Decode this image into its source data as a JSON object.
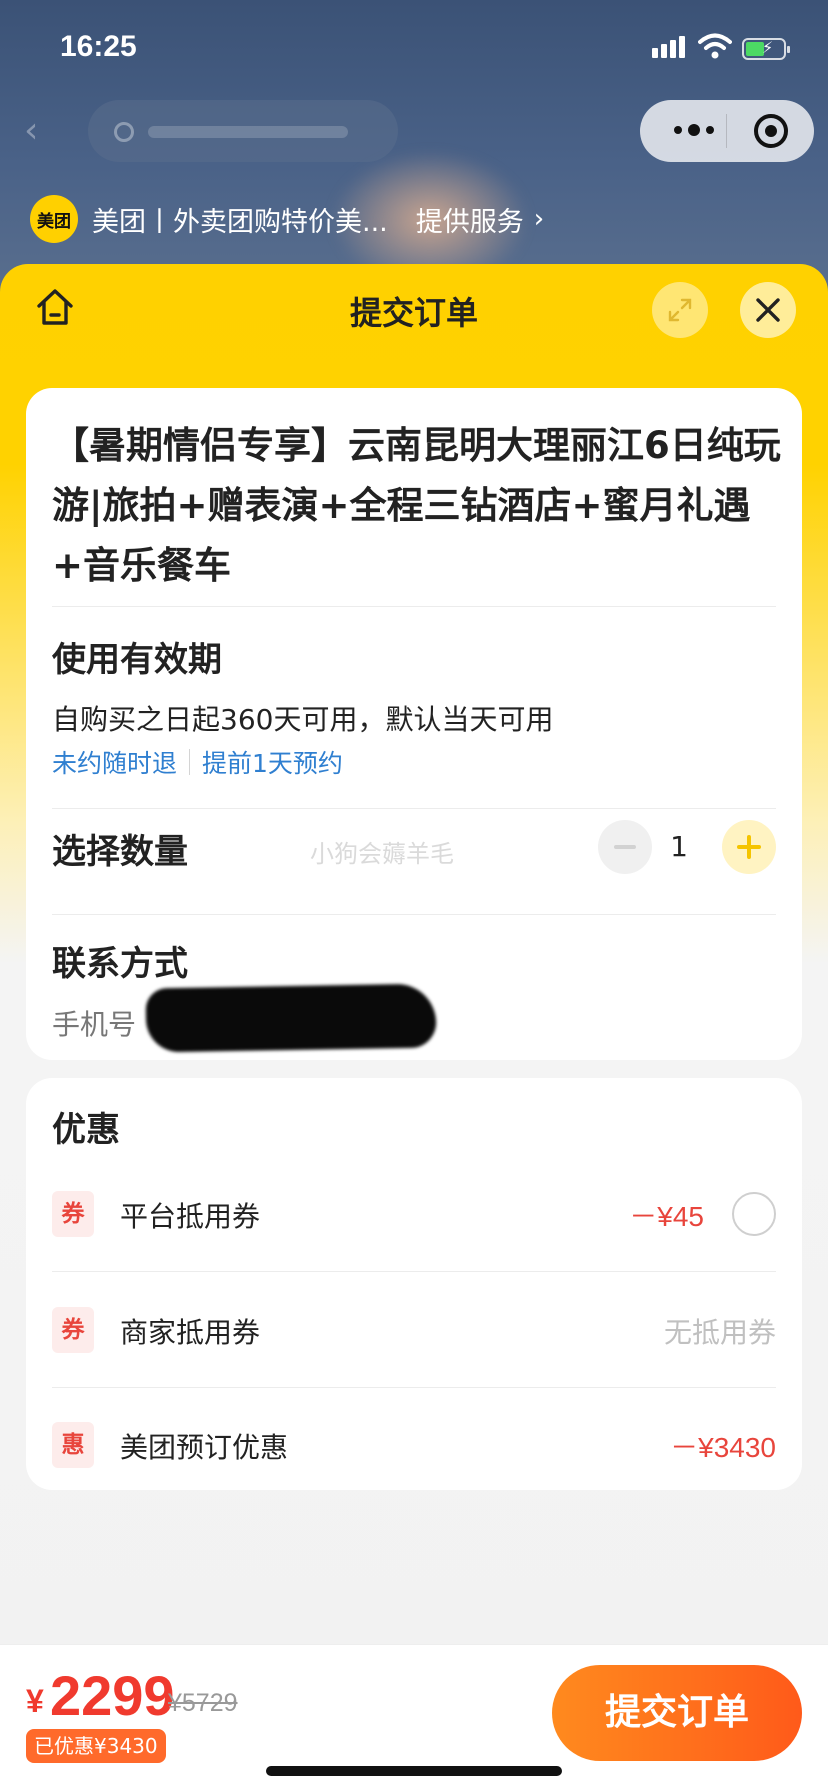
{
  "status_bar": {
    "time": "16:25"
  },
  "mini_program": {
    "logo_text": "美团",
    "name": "美团丨外卖团购特价美...",
    "service_link": "提供服务",
    "service_chevron": "›"
  },
  "sheet": {
    "title": "提交订单",
    "icons": [
      "home-icon",
      "expand-icon",
      "close-icon"
    ]
  },
  "product": {
    "title": "【暑期情侣专享】云南昆明大理丽江6日纯玩游|旅拍+赠表演+全程三钻酒店+蜜月礼遇+音乐餐车"
  },
  "validity": {
    "label": "使用有效期",
    "text": "自购买之日起360天可用，默认当天可用",
    "tag_refund": "未约随时退",
    "tag_booking": "提前1天预约"
  },
  "quantity": {
    "label": "选择数量",
    "value": "1"
  },
  "watermark": "小狗会薅羊毛",
  "contact": {
    "label": "联系方式",
    "phone_label": "手机号"
  },
  "discounts": {
    "title": "优惠",
    "rows": [
      {
        "badge": "券",
        "name": "平台抵用券",
        "amount": "－¥45",
        "has_radio": true
      },
      {
        "badge": "券",
        "name": "商家抵用券",
        "amount": "无抵用券"
      },
      {
        "badge": "惠",
        "name": "美团预订优惠",
        "amount": "－¥3430"
      }
    ]
  },
  "footer": {
    "currency": "¥",
    "price": "2299",
    "original_price": "¥5729",
    "saved": "已优惠¥3430",
    "submit_label": "提交订单"
  },
  "colors": {
    "brand_yellow": "#ffd100",
    "price_red": "#f03a2e",
    "link_blue": "#2f7fd0",
    "submit_orange": "#ff6a1e"
  }
}
